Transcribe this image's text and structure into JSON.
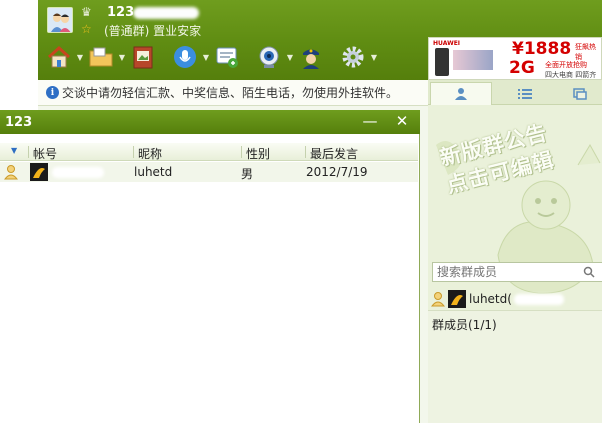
{
  "header": {
    "group_name": "123",
    "group_type": "(普通群) 置业安家"
  },
  "toolbar": {
    "items": [
      "home-icon",
      "folder-icon",
      "photo-album-icon",
      "microphone-icon",
      "message-icon",
      "webcam-icon",
      "police-icon",
      "gear-icon"
    ]
  },
  "ad": {
    "logo": "HUAWEI",
    "price": "¥1888",
    "tag": "狂飙热销",
    "badge": "2G",
    "line1": "全面开放抢购",
    "line2": "四大电商 四箭齐发"
  },
  "notice": {
    "text": "交谈中请勿轻信汇款、中奖信息、陌生电话，勿使用外挂软件。"
  },
  "popup": {
    "title": "123",
    "minimize": "—",
    "close": "✕",
    "columns": [
      "帐号",
      "昵称",
      "性别",
      "最后发言"
    ],
    "rows": [
      {
        "account": "",
        "nickname": "luhetd",
        "gender": "男",
        "last_speak": "2012/7/19"
      }
    ]
  },
  "right_panel": {
    "bulletin_text": "新版群公告\n点击可编辑",
    "members_title": "群成员(1/1)",
    "search_placeholder": "搜索群成员",
    "member_name": "luhetd("
  },
  "colors": {
    "accent_green": "#5f8c12",
    "panel_bg": "#eef3e2",
    "ad_red": "#d40000"
  }
}
